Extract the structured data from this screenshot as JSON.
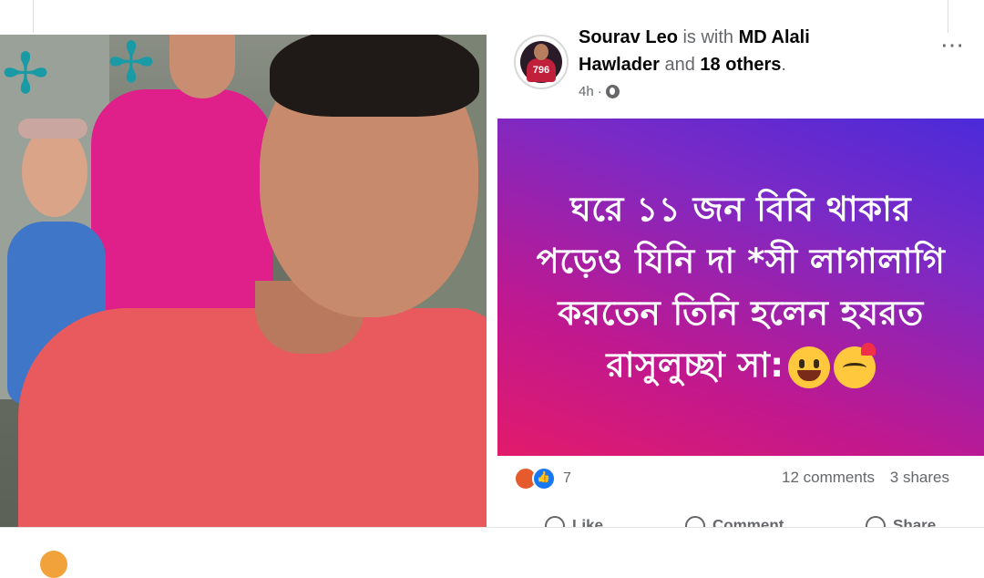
{
  "post": {
    "author": "Sourav Leo",
    "with_text": " is with ",
    "tagged": "MD Alali",
    "tagged2": "Hawlader",
    "and_text": " and ",
    "others": "18 others",
    "period": ".",
    "time": "4h",
    "dot": "·",
    "avatar_number": "796",
    "more_icon": "⋯",
    "banner_text": "ঘরে ১১ জন বিবি থাকার পড়েও যিনি দা *সী লাগালাগি করতেন তিনি হলেন হযরত রাসুলুচ্ছা সা:",
    "reaction_count": "7",
    "comments": "12 comments",
    "shares": "3 shares",
    "actions": [
      "Like",
      "Comment",
      "Share"
    ]
  },
  "colors": {
    "banner_start": "#4b2bd9",
    "banner_end": "#e21b6b",
    "like_blue": "#1877f2",
    "angry_orange": "#e65b2b"
  },
  "icons": [
    "globe-icon",
    "more-options-icon",
    "angry-reaction-icon",
    "like-reaction-icon",
    "grinning-emoji",
    "smiling-hearts-emoji"
  ]
}
